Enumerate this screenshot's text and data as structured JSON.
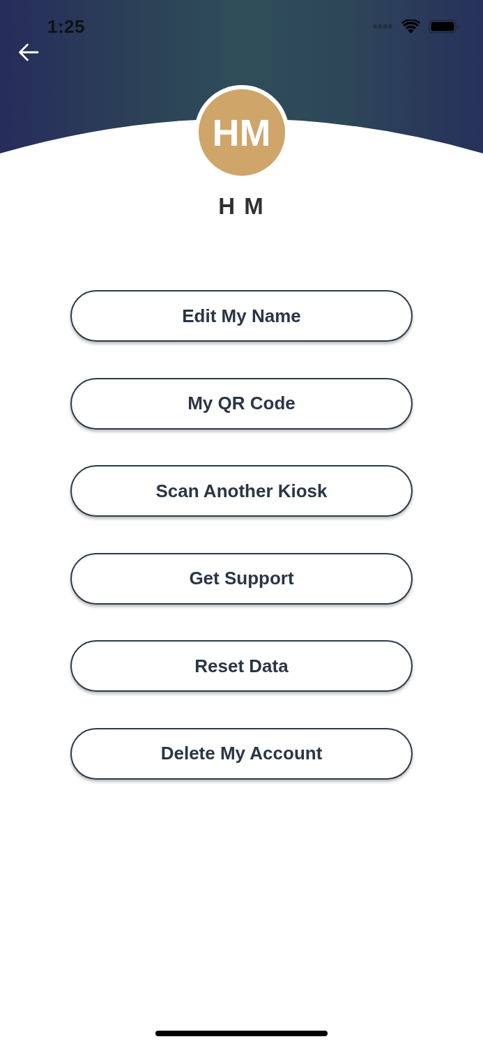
{
  "status_bar": {
    "time": "1:25"
  },
  "profile": {
    "initials": "HM",
    "name": "H M"
  },
  "menu": [
    "Edit My Name",
    "My QR Code",
    "Scan Another Kiosk",
    "Get Support",
    "Reset Data",
    "Delete My Account"
  ]
}
